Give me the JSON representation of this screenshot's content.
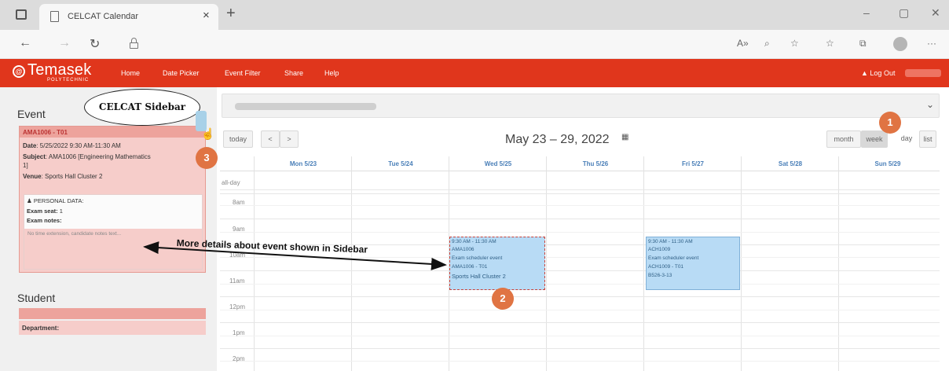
{
  "browser": {
    "tab_title": "CELCAT Calendar",
    "tab_close": "×",
    "new_tab": "+",
    "minimize": "–",
    "restore": "▢",
    "close": "✕"
  },
  "app": {
    "logo_main": "Temasek",
    "logo_sub": "POLYTECHNIC",
    "nav": [
      "Home",
      "Date Picker",
      "Event Filter",
      "Share",
      "Help"
    ],
    "logout": "Log Out"
  },
  "sidebar": {
    "event_heading": "Event",
    "event_code": "AMA1006 - T01",
    "date_label": "Date",
    "date_value": "5/25/2022 9:30 AM-11:30 AM",
    "subject_label": "Subject",
    "subject_value": "AMA1006 [Engineering Mathematics",
    "subject_cont": "1]",
    "venue_label": "Venue",
    "venue_value": "Sports Hall Cluster 2",
    "personal_data": "PERSONAL DATA:",
    "exam_seat_label": "Exam seat:",
    "exam_seat_value": "1",
    "exam_notes_label": "Exam notes:",
    "notes_text": "No time extension, candidate notes text...",
    "student_heading": "Student",
    "department_label": "Department:"
  },
  "callout": {
    "text": "CELCAT Sidebar"
  },
  "calendar": {
    "today": "today",
    "prev": "<",
    "next": ">",
    "title": "May 23 – 29, 2022",
    "views": [
      "month",
      "week",
      "day",
      "list"
    ],
    "active_view": "week",
    "days": [
      "Mon 5/23",
      "Tue 5/24",
      "Wed 5/25",
      "Thu 5/26",
      "Fri 5/27",
      "Sat 5/28",
      "Sun 5/29"
    ],
    "times": [
      "all-day",
      "8am",
      "9am",
      "10am",
      "11am",
      "12pm",
      "1pm",
      "2pm"
    ],
    "events": [
      {
        "day": "Wed 5/25",
        "lines": [
          "9:30 AM - 11:30 AM",
          "AMA1006",
          "Exam scheduler event",
          "AMA1006 - T01",
          "Sports Hall Cluster 2"
        ],
        "selected": true
      },
      {
        "day": "Fri 5/27",
        "lines": [
          "9:30 AM - 11:30 AM",
          "ACH1009",
          "Exam scheduler event",
          "ACH1009 - T01",
          "B526-3-13"
        ],
        "selected": false
      }
    ]
  },
  "annotations": {
    "badge1": "1",
    "badge2": "2",
    "badge3": "3",
    "arrow_text": "More details about event shown in Sidebar"
  },
  "colors": {
    "brand": "#e0361c",
    "event_fill": "#b8dbf5",
    "sidebar_highlight": "#f6cdca",
    "badge": "#e07443",
    "day_header": "#4a7fb8"
  }
}
